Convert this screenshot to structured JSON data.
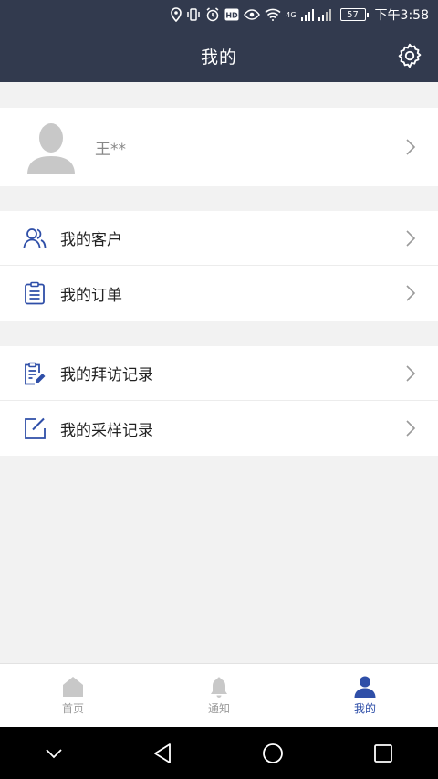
{
  "status_bar": {
    "network": "4G",
    "battery": "57",
    "time": "下午3:58"
  },
  "header": {
    "title": "我的",
    "settings_icon": "gear-icon"
  },
  "profile": {
    "name": "王**",
    "avatar_icon": "user-silhouette-icon"
  },
  "menu_groups": [
    {
      "items": [
        {
          "label": "我的客户",
          "icon": "customers-icon"
        },
        {
          "label": "我的订单",
          "icon": "clipboard-icon"
        }
      ]
    },
    {
      "items": [
        {
          "label": "我的拜访记录",
          "icon": "visit-record-icon"
        },
        {
          "label": "我的采样记录",
          "icon": "edit-square-icon"
        }
      ]
    }
  ],
  "tab_bar": {
    "tabs": [
      {
        "label": "首页",
        "icon": "home-icon",
        "active": false
      },
      {
        "label": "通知",
        "icon": "bell-icon",
        "active": false
      },
      {
        "label": "我的",
        "icon": "person-icon",
        "active": true
      }
    ]
  },
  "colors": {
    "header_bg": "#323a4e",
    "accent": "#2f4fa8",
    "inactive_tab": "#c8c8c8",
    "page_bg": "#f2f2f2"
  }
}
